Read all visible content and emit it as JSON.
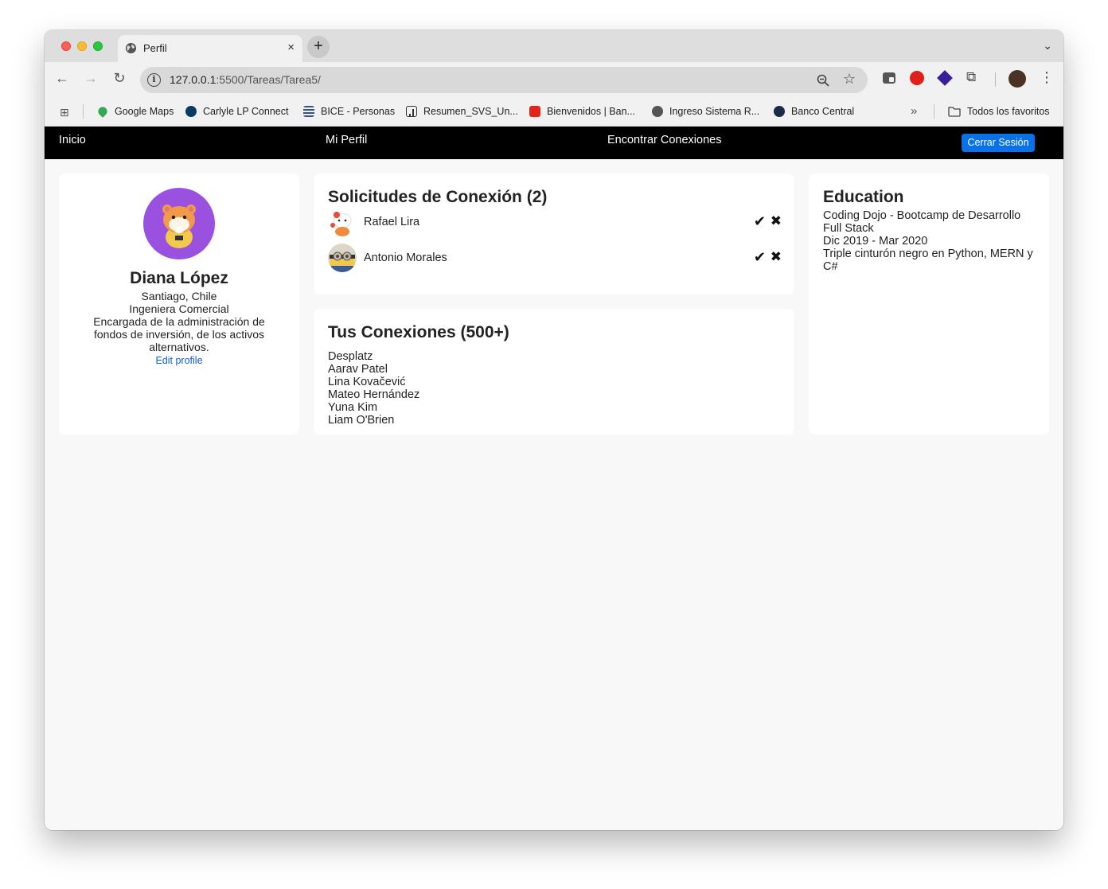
{
  "browser": {
    "tab_title": "Perfil",
    "tab_close": "×",
    "new_tab": "+",
    "url_host": "127.0.0.1",
    "url_path": ":5500/Tareas/Tarea5/",
    "bookmarks": [
      {
        "label": "Google Maps",
        "icon": "google-maps-icon",
        "color": "#34a853"
      },
      {
        "label": "Carlyle LP Connect",
        "icon": "carlyle-icon",
        "color": "#0b3a66"
      },
      {
        "label": "BICE - Personas",
        "icon": "bice-icon",
        "color": "#33508f"
      },
      {
        "label": "Resumen_SVS_Un...",
        "icon": "chart-icon",
        "color": "#333333"
      },
      {
        "label": "Bienvenidos | Ban...",
        "icon": "santander-icon",
        "color": "#e3241b"
      },
      {
        "label": "Ingreso Sistema R...",
        "icon": "globe-icon",
        "color": "#555555"
      },
      {
        "label": "Banco Central",
        "icon": "banco-central-icon",
        "color": "#1b2a4a"
      }
    ],
    "bookmarks_folder": "Todos los favoritos"
  },
  "nav": {
    "inicio": "Inicio",
    "mi_perfil": "Mi Perfil",
    "encontrar": "Encontrar Conexiones",
    "logout": "Cerrar Sesión"
  },
  "profile": {
    "name": "Diana López",
    "location": "Santiago, Chile",
    "title": "Ingeniera Comercial",
    "bio": "Encargada de la administración de fondos de inversión, de los activos alternativos.",
    "edit_link": "Edit profile",
    "avatar_color": "#9b51e0"
  },
  "requests": {
    "title": "Solicitudes de Conexión (2)",
    "items": [
      {
        "name": "Rafael Lira",
        "accept": "✔",
        "reject": "✖"
      },
      {
        "name": "Antonio Morales",
        "accept": "✔",
        "reject": "✖"
      }
    ]
  },
  "connections": {
    "title": "Tus Conexiones (500+)",
    "items": [
      "Desplatz",
      "Aarav Patel",
      "Lina Kovačević",
      "Mateo Hernández",
      "Yuna Kim",
      "Liam O'Brien"
    ]
  },
  "education": {
    "title": "Education",
    "school": "Coding Dojo - Bootcamp de Desarrollo Full Stack",
    "dates": "Dic 2019 - Mar 2020",
    "achievement": "Triple cinturón negro en Python, MERN y C#"
  },
  "colors": {
    "accent_button": "#0a72e8",
    "link": "#0a5fd6",
    "navbar": "#000000"
  }
}
